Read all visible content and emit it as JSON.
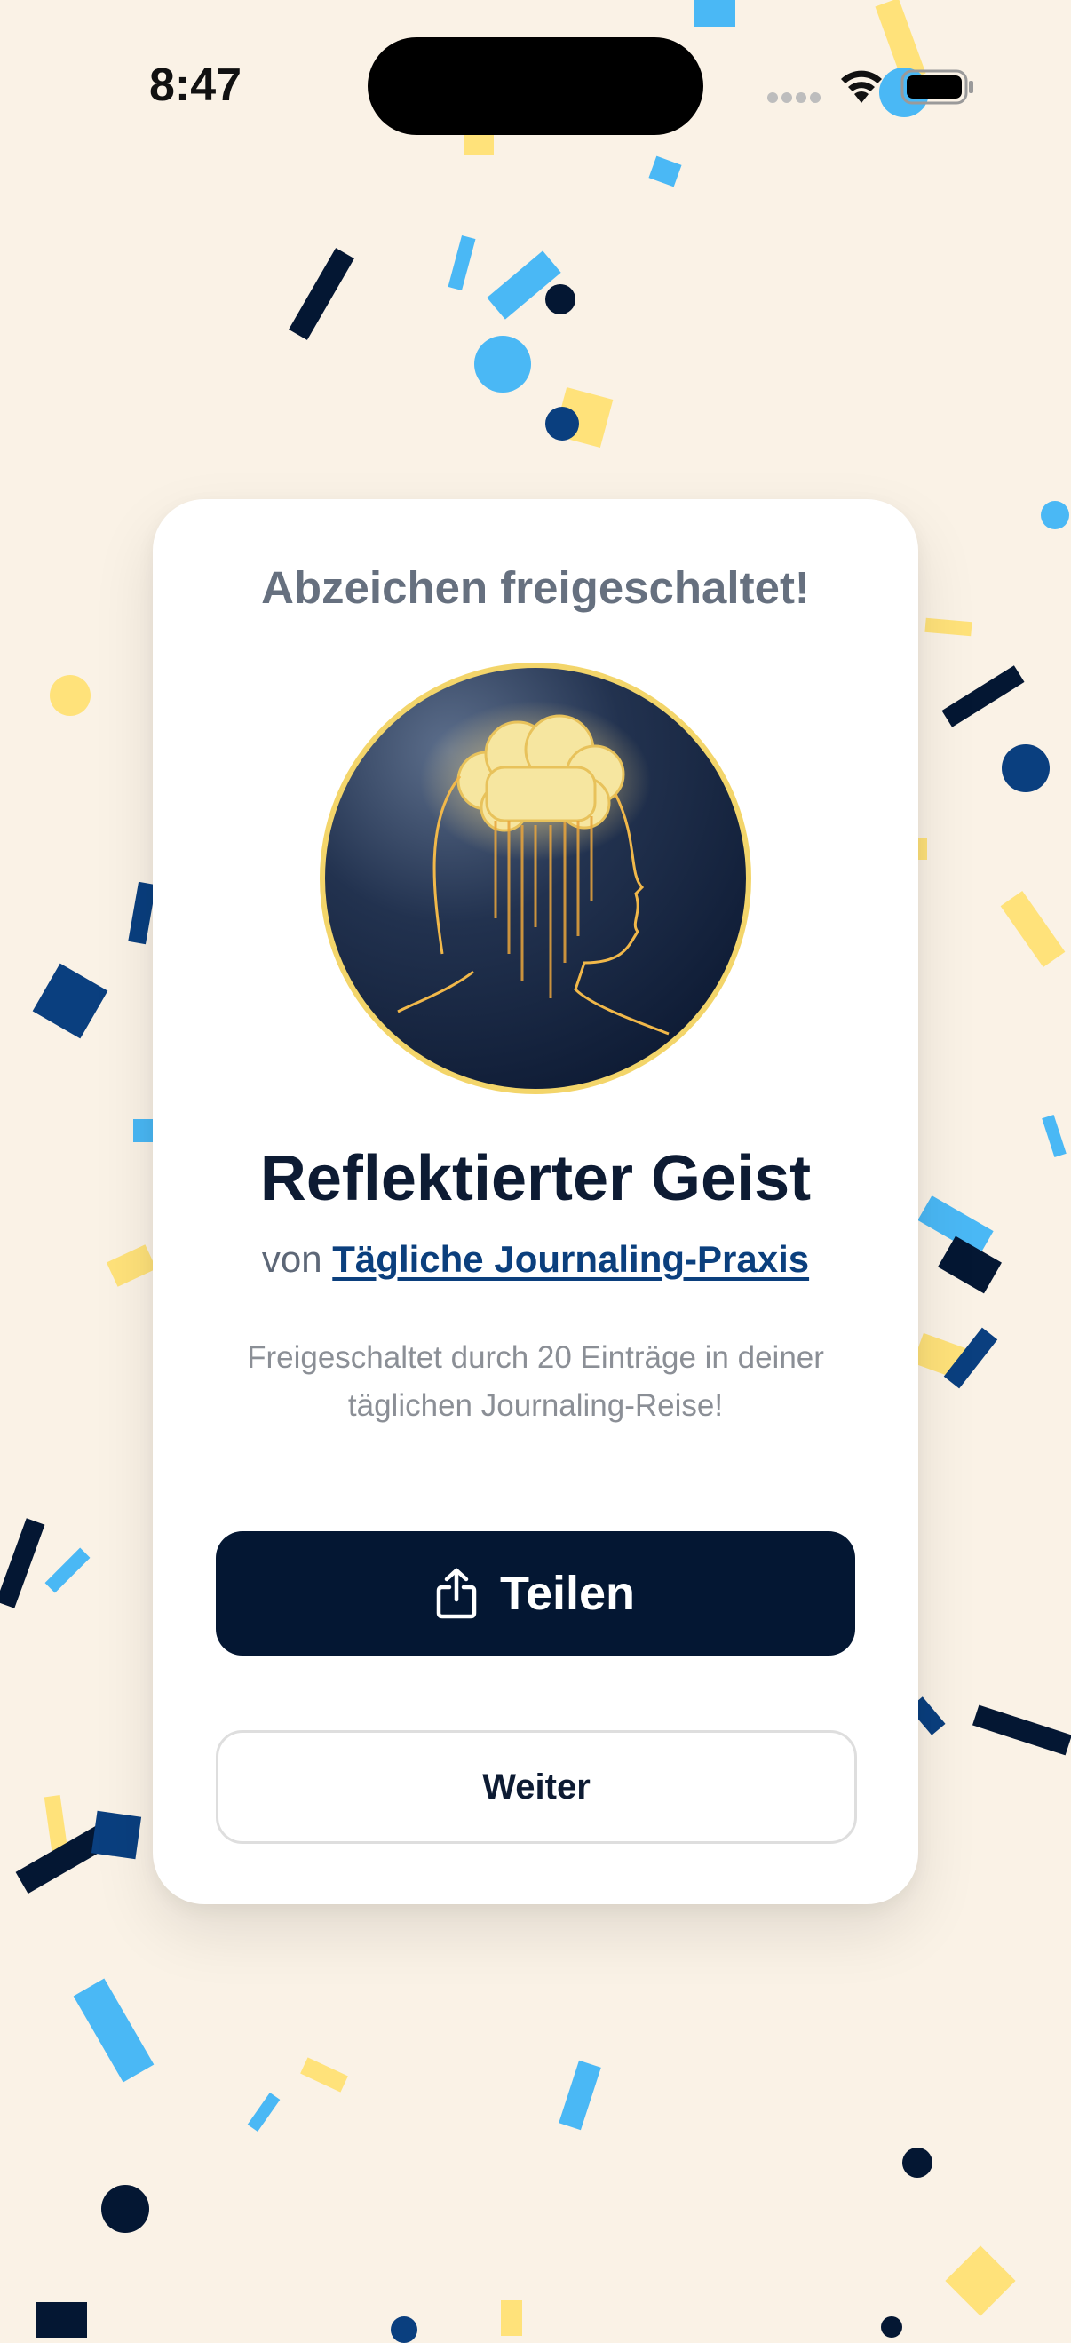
{
  "status_bar": {
    "time": "8:47"
  },
  "card": {
    "title": "Abzeichen freigeschaltet!",
    "badge_name": "Reflektierter Geist",
    "byline_prefix": "von",
    "byline_link": "Tägliche Journaling-Praxis",
    "description": "Freigeschaltet durch 20 Einträge in deiner täglichen Journaling-Reise!",
    "share_label": "Teilen",
    "next_label": "Weiter"
  },
  "colors": {
    "background": "#faf2e6",
    "primary_button": "#041733",
    "link": "#0b3f7d",
    "confetti": [
      "#041733",
      "#4ab8f5",
      "#ffe27a",
      "#0a3f7f"
    ]
  },
  "icons": {
    "share": "share-icon",
    "wifi": "wifi-icon",
    "battery": "battery-icon"
  }
}
